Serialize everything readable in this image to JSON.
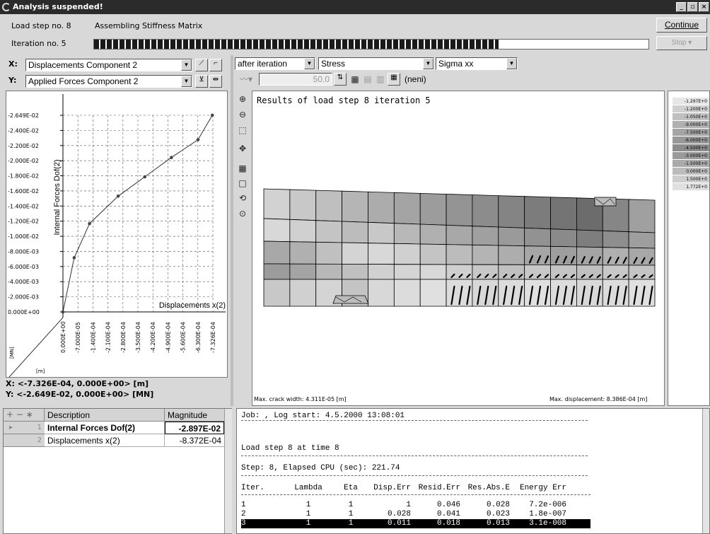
{
  "title": "Analysis suspended!",
  "status": {
    "load_step": "Load step no. 8",
    "action": "Assembling Stiffness Matrix",
    "iteration": "Iteration no. 5",
    "progress": 0.73
  },
  "buttons": {
    "continue": "Continue",
    "stop": "Stop"
  },
  "axes": {
    "x_label": "X:",
    "x_value": "Displacements Component 2",
    "y_label": "Y:",
    "y_value": "Applied Forces Component 2"
  },
  "view": {
    "when": "after iteration",
    "quantity": "Stress",
    "component": "Sigma xx",
    "scale_value": "50.0",
    "neni": "(neni)"
  },
  "chart_data": {
    "type": "line",
    "title": "",
    "xlabel": "Displacements x(2)",
    "ylabel": "Internal Forces Dof(2)",
    "x_unit": "[m]",
    "y_unit": "[MN]",
    "y_ticks": [
      "-2.649E-02",
      "-2.400E-02",
      "-2.200E-02",
      "-2.000E-02",
      "-1.800E-02",
      "-1.600E-02",
      "-1.400E-02",
      "-1.200E-02",
      "-1.000E-02",
      "-8.000E-03",
      "-6.000E-03",
      "-4.000E-03",
      "-2.000E-03",
      "0.000E+00"
    ],
    "x_ticks": [
      "0.000E+00",
      "-7.000E-05",
      "-1.400E-04",
      "-2.100E-04",
      "-2.800E-04",
      "-3.500E-04",
      "-4.200E-04",
      "-4.900E-04",
      "-5.600E-04",
      "-6.300E-04",
      "-7.326E-04"
    ],
    "x": [
      0,
      -5.5e-05,
      -0.00013,
      -0.00027,
      -0.0004,
      -0.00053,
      -0.00066,
      -0.00073
    ],
    "y": [
      0,
      -0.0073,
      -0.0119,
      -0.0156,
      -0.0182,
      -0.0208,
      -0.0232,
      -0.0265
    ],
    "xlim": [
      0,
      -0.0007326
    ],
    "ylim": [
      0,
      -0.02649
    ],
    "grid": true
  },
  "chart_readout": {
    "x": "X: <-7.326E-04, 0.000E+00> [m]",
    "y": "Y: <-2.649E-02, 0.000E+00> [MN]"
  },
  "results": {
    "title": "Results of load step 8 iteration 5",
    "crack_width": "Max. crack width:  4.311E-05 [m]",
    "max_disp": "Max. displacement:  8.386E-04 [m]"
  },
  "legend": [
    "-1.297E+0",
    "-1.200E+0",
    "-1.050E+0",
    "-9.000E+0",
    "-7.500E+0",
    "-6.000E+0",
    "-4.500E+0",
    "-3.000E+0",
    "-1.500E+0",
    "0.000E+0",
    "1.500E+0",
    "1.772E+0"
  ],
  "legend_colors": [
    "#e6e6e6",
    "#d0d0d0",
    "#c0c0c0",
    "#b0b0b0",
    "#a4a4a4",
    "#989898",
    "#8c8c8c",
    "#9a9a9a",
    "#aaaaaa",
    "#bcbcbc",
    "#cecece",
    "#e0e0e0"
  ],
  "monitor": {
    "headers": [
      "Description",
      "Magnitude"
    ],
    "rows": [
      {
        "n": "1",
        "desc": "Internal Forces Dof(2)",
        "mag": "-2.897E-02"
      },
      {
        "n": "2",
        "desc": "Displacements x(2)",
        "mag": "-8.372E-04"
      }
    ]
  },
  "log": {
    "line1": "Job: , Log start: 4.5.2000 13:08:01",
    "line2": "Load step 8 at time 8",
    "line3": "Step: 8, Elapsed CPU (sec): 221.74",
    "headers": [
      "Iter.",
      "Lambda",
      "Eta",
      "Disp.Err",
      "Resid.Err",
      "Res.Abs.E",
      "Energy Err"
    ],
    "rows": [
      [
        "1",
        "1",
        "1",
        "1",
        "0.046",
        "0.028",
        "7.2e-006"
      ],
      [
        "2",
        "1",
        "1",
        "0.028",
        "0.041",
        "0.023",
        "1.8e-007"
      ],
      [
        "3",
        "1",
        "1",
        "0.011",
        "0.018",
        "0.013",
        "3.1e-008"
      ]
    ]
  }
}
